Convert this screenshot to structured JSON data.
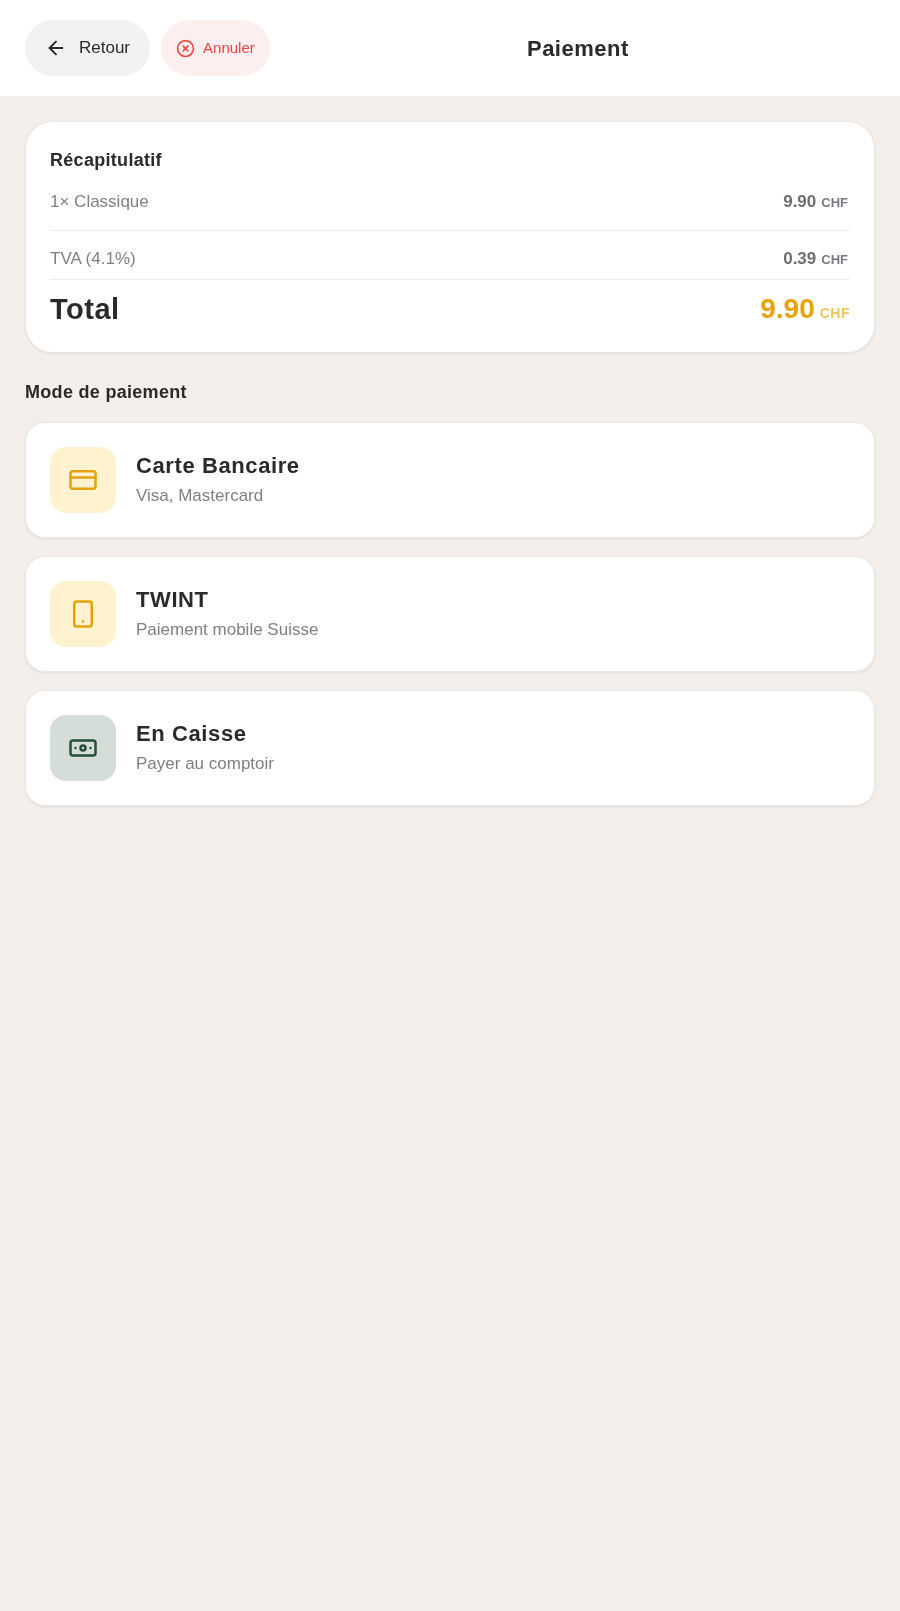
{
  "header": {
    "back_button": {
      "label": "Retour"
    },
    "cancel_button": {
      "label": "Annuler"
    },
    "title": "Paiement"
  },
  "summary": {
    "title": "Récapitulatif",
    "lines": [
      {
        "label": "1× Classique",
        "amount": "9.90",
        "currency": "CHF"
      },
      {
        "label": "TVA (4.1%)",
        "amount": "0.39",
        "currency": "CHF"
      }
    ],
    "total": {
      "label": "Total",
      "amount": "9.90",
      "currency": "CHF"
    }
  },
  "payment": {
    "heading": "Mode de paiement",
    "methods": [
      {
        "kind": "card",
        "title": "Carte Bancaire",
        "subtitle": "Visa, Mastercard"
      },
      {
        "kind": "mobile",
        "title": "TWINT",
        "subtitle": "Paiement mobile Suisse"
      },
      {
        "kind": "cash",
        "title": "En Caisse",
        "subtitle": "Payer au comptoir"
      }
    ]
  }
}
